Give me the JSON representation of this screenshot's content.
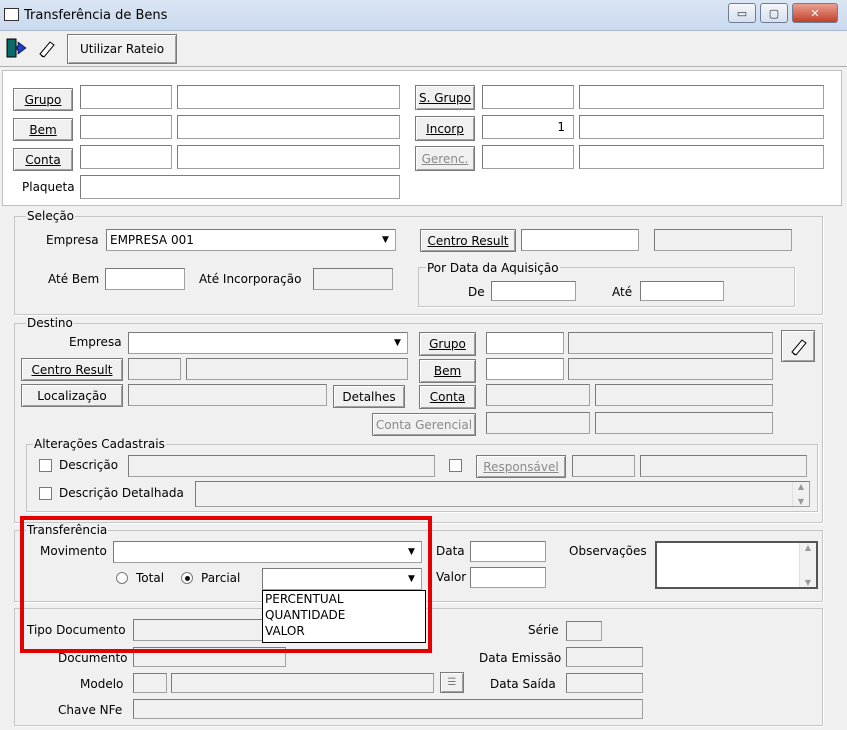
{
  "window": {
    "title": "Transferência de Bens",
    "min_label": "▭",
    "max_label": "▢",
    "close_label": "✕"
  },
  "toolbar": {
    "exit_icon": "exit-door-icon",
    "eraser_icon": "eraser-icon",
    "rateio_label": "Utilizar Rateio"
  },
  "top": {
    "grupo_label": "Grupo",
    "bem_label": "Bem",
    "conta_label": "Conta",
    "plaqueta_label": "Plaqueta",
    "sgrupo_label": "S. Grupo",
    "incorp_label": "Incorp",
    "gerenc_label": "Gerenc.",
    "incorp_value": "1"
  },
  "selecao": {
    "title": "Seleção",
    "empresa_label": "Empresa",
    "empresa_value": "EMPRESA 001",
    "centro_result_label": "Centro Result",
    "ate_bem_label": "Até Bem",
    "ate_incorp_label": "Até Incorporação",
    "por_data_title": "Por Data da Aquisição",
    "de_label": "De",
    "ate_label": "Até"
  },
  "destino": {
    "title": "Destino",
    "empresa_label": "Empresa",
    "centro_result_label": "Centro Result",
    "localizacao_label": "Localização",
    "detalhes_label": "Detalhes",
    "grupo_label": "Grupo",
    "bem_label": "Bem",
    "conta_label": "Conta",
    "conta_gerencial_label": "Conta Gerencial"
  },
  "alteracoes": {
    "title": "Alterações Cadastrais",
    "descricao_label": "Descrição",
    "descricao_detalhada_label": "Descrição Detalhada",
    "responsavel_label": "Responsável"
  },
  "transferencia": {
    "title": "Transferência",
    "movimento_label": "Movimento",
    "total_label": "Total",
    "parcial_label": "Parcial",
    "selected_mode": "Parcial",
    "data_label": "Data",
    "valor_label": "Valor",
    "observacoes_label": "Observações",
    "dropdown_options": [
      "PERCENTUAL",
      "QUANTIDADE",
      "VALOR"
    ]
  },
  "documento": {
    "tipo_documento_label": "Tipo Documento",
    "documento_label": "Documento",
    "modelo_label": "Modelo",
    "chave_nfe_label": "Chave NFe",
    "serie_label": "Série",
    "data_emissao_label": "Data Emissão",
    "data_saida_label": "Data Saída"
  },
  "colors": {
    "highlight": "#e30000",
    "window_bg": "#f0f0f0"
  }
}
